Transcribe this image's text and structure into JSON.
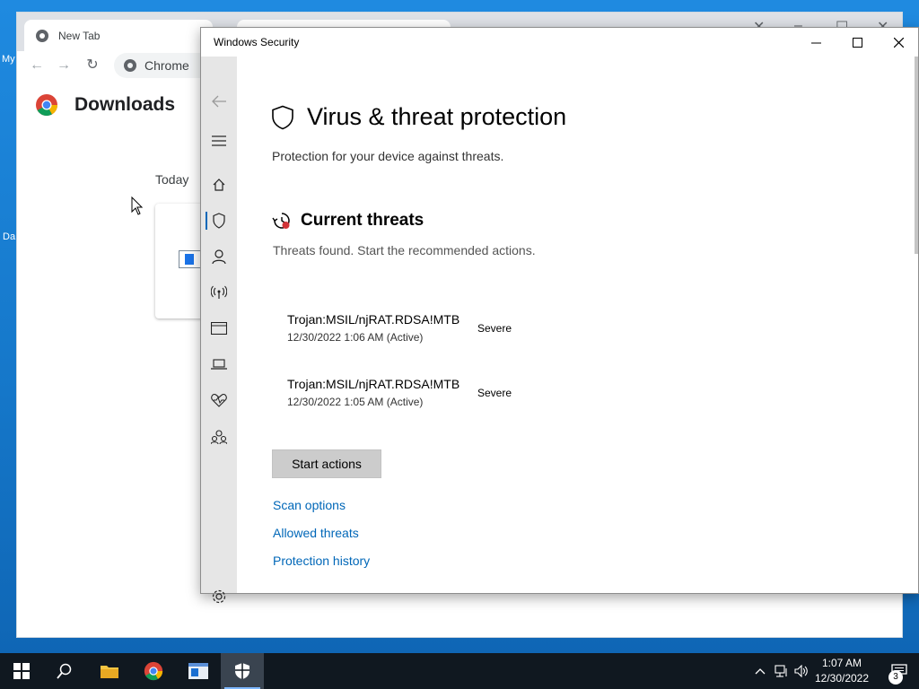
{
  "desktop": {
    "icon_label_1": "My",
    "icon_label_2": "Da"
  },
  "chrome": {
    "tab_title": "New Tab",
    "omnibox_text": "Chrome",
    "page_title": "Downloads",
    "section_label": "Today"
  },
  "security": {
    "window_title": "Windows Security",
    "page_title": "Virus & threat protection",
    "page_subtitle": "Protection for your device against threats.",
    "section_title": "Current threats",
    "section_subtitle": "Threats found. Start the recommended actions.",
    "threats": [
      {
        "name": "Trojan:MSIL/njRAT.RDSA!MTB",
        "date": "12/30/2022 1:06 AM (Active)",
        "severity": "Severe"
      },
      {
        "name": "Trojan:MSIL/njRAT.RDSA!MTB",
        "date": "12/30/2022 1:05 AM (Active)",
        "severity": "Severe"
      }
    ],
    "start_button": "Start actions",
    "links": {
      "scan_options": "Scan options",
      "allowed_threats": "Allowed threats",
      "protection_history": "Protection history"
    },
    "sidebar": [
      "back-icon",
      "menu-icon",
      "home-icon",
      "shield-icon",
      "account-icon",
      "network-icon",
      "app-browser-icon",
      "device-security-icon",
      "health-icon",
      "family-icon",
      "settings-icon"
    ],
    "accent_color": "#0067b8",
    "alert_color": "#d13438"
  },
  "taskbar": {
    "time": "1:07 AM",
    "date": "12/30/2022",
    "notification_count": "3"
  }
}
